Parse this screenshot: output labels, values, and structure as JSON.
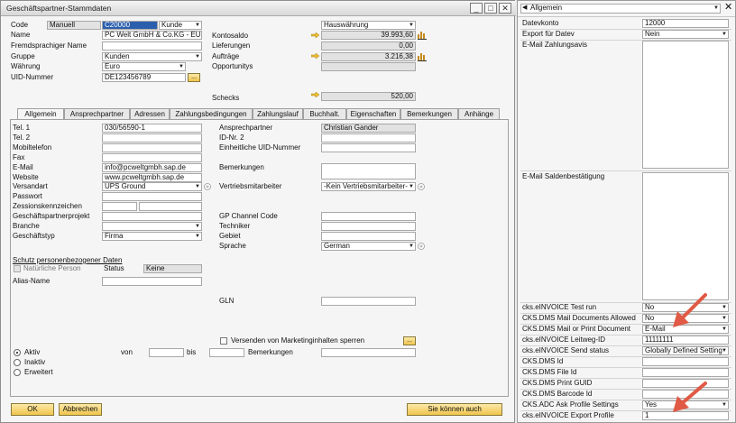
{
  "window": {
    "title": "Geschäftspartner-Stammdaten",
    "buttons": [
      "_",
      "□",
      "✕"
    ]
  },
  "header": {
    "code_label": "Code",
    "code_type": "Manuell",
    "code_value": "C20000",
    "code_kind": "Kunde",
    "name_label": "Name",
    "name_value": "PC Welt GmbH & Co.KG - EUR",
    "foreign_name_label": "Fremdsprachiger Name",
    "group_label": "Gruppe",
    "group_value": "Kunden",
    "currency_label": "Währung",
    "currency_value": "Euro",
    "vat_label": "UID-Nummer",
    "vat_value": "DE123456789",
    "dots": "...",
    "currency_mode": "Hauswährung",
    "balance_label": "Kontosaldo",
    "balance_value": "39.993,60",
    "deliveries_label": "Lieferungen",
    "deliveries_value": "0,00",
    "orders_label": "Aufträge",
    "orders_value": "3.216,38",
    "opportunities_label": "Opportunitys",
    "checks_label": "Schecks",
    "checks_value": "520,00"
  },
  "tabs": [
    "Allgemein",
    "Ansprechpartner",
    "Adressen",
    "Zahlungsbedingungen",
    "Zahlungslauf",
    "Buchhalt.",
    "Eigenschaften",
    "Bemerkungen",
    "Anhänge"
  ],
  "general": {
    "tel1_label": "Tel. 1",
    "tel1_value": "030/56590-1",
    "tel2_label": "Tel. 2",
    "mobile_label": "Mobiltelefon",
    "fax_label": "Fax",
    "email_label": "E-Mail",
    "email_value": "info@pcweltgmbh.sap.de",
    "website_label": "Website",
    "website_value": "www.pcweltgmbh.sap.de",
    "shipping_label": "Versandart",
    "shipping_value": "UPS Ground",
    "password_label": "Passwort",
    "sessions_label": "Zessionskennzeichen",
    "project_label": "Geschäftspartnerprojekt",
    "industry_label": "Branche",
    "business_type_label": "Geschäftstyp",
    "business_type_value": "Firma",
    "privacy_label": "Schutz personenbezogener Daten",
    "natural_person_label": "Natürliche Person",
    "status_label": "Status",
    "status_value": "Keine",
    "alias_label": "Alias-Name",
    "contact_label": "Ansprechpartner",
    "contact_value": "Christian Gander",
    "id2_label": "ID-Nr. 2",
    "uid_label": "Einheitliche UID-Nummer",
    "remarks_label": "Bemerkungen",
    "sales_employee_label": "Vertriebsmitarbeiter",
    "sales_employee_value": "-Kein Vertriebsmitarbeiter-",
    "channel_label": "GP Channel Code",
    "technician_label": "Techniker",
    "territory_label": "Gebiet",
    "language_label": "Sprache",
    "language_value": "German",
    "gln_label": "GLN",
    "marketing_label": "Versenden von Marketinginhalten sperren",
    "active_label": "Aktiv",
    "inactive_label": "Inaktiv",
    "advanced_label": "Erweitert",
    "from_label": "von",
    "to_label": "bis",
    "remarks2_label": "Bemerkungen"
  },
  "footer": {
    "ok": "OK",
    "cancel": "Abbrechen",
    "also": "Sie können auch"
  },
  "side": {
    "header_value": "Allgemein",
    "fields": [
      {
        "label": "Datevkonto",
        "value": "12000"
      },
      {
        "label": "Export für Datev",
        "value": "Nein"
      },
      {
        "label": "E-Mail Zahlungsavis",
        "value": ""
      }
    ],
    "saldo_label": "E-Mail Saldenbestätigung",
    "lower_fields": [
      {
        "label": "cks.eINVOICE Test run",
        "value": "No"
      },
      {
        "label": "CKS.DMS Mail Documents Allowed",
        "value": "No"
      },
      {
        "label": "CKS.DMS Mail or Print Document",
        "value": "E-Mail"
      },
      {
        "label": "cks.eINVOICE Leitweg-ID",
        "value": "11111111"
      },
      {
        "label": "cks.eINVOICE Send status",
        "value": "Globally Defined Setting"
      },
      {
        "label": "CKS.DMS Id",
        "value": ""
      },
      {
        "label": "CKS.DMS File Id",
        "value": ""
      },
      {
        "label": "CKS.DMS Print GUID",
        "value": ""
      },
      {
        "label": "CKS.DMS Barcode Id",
        "value": ""
      },
      {
        "label": "CKS.ADC Ask Profile Settings",
        "value": "Yes"
      },
      {
        "label": "cks.eINVOICE Export Profile",
        "value": "1"
      }
    ]
  },
  "colors": {
    "accent_arrow": "#e05a45",
    "link_arrow": "#f0c030",
    "button_gold": "#f0c44c",
    "selection_blue": "#2b5fae"
  }
}
